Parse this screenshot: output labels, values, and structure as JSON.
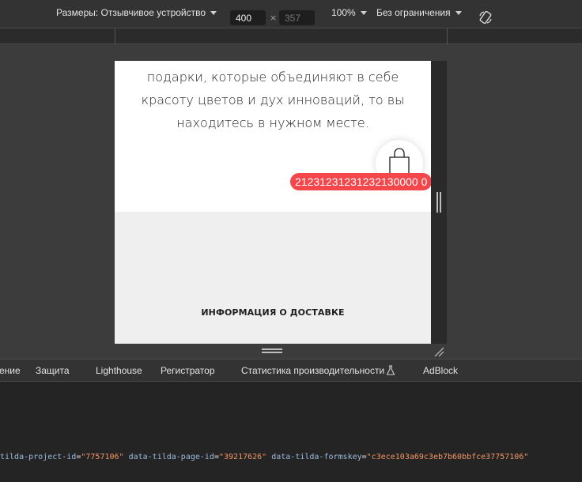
{
  "toolbar": {
    "dimensions_label": "Размеры: Отзывчивое устройство",
    "width_value": "400",
    "times": "×",
    "height_placeholder": "357",
    "zoom": "100%",
    "throttling": "Без ограничения"
  },
  "page": {
    "text_lines": [
      "подарки, которые объединяют в себе",
      "красоту цветов и дух инноваций, то вы",
      "находитесь в нужном месте."
    ],
    "cart_badge": "21231231231232130000 0",
    "delivery_title": "ИНФОРМАЦИЯ О ДОСТАВКЕ"
  },
  "devtools": {
    "tabs": [
      "ение",
      "Защита",
      "Lighthouse",
      "Регистратор",
      "Статистика производительности",
      "AdBlock"
    ],
    "code": {
      "attr1": "tilda-project-id",
      "val1": "\"7757106\"",
      "attr2": "data-tilda-page-id",
      "val2": "\"39217626\"",
      "attr3": "data-tilda-formskey",
      "val3": "\"c3ece103a69c3eb7b60bbfce37757106\""
    }
  },
  "colors": {
    "badge": "#f3474c",
    "attr": "#9bbbdc",
    "value": "#f29766"
  }
}
